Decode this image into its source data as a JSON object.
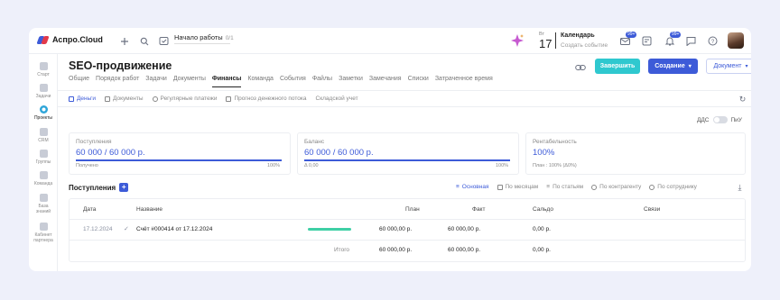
{
  "app": {
    "logo_text": "Аспро.Cloud",
    "brand_color": "#3d5bd8"
  },
  "topbar": {
    "start_work_label": "Начало работы",
    "start_work_count": "0/1",
    "calendar": {
      "day_of_week": "Вт",
      "day": "17",
      "title": "Календарь",
      "subtitle": "Создать событие"
    },
    "badges": {
      "mail": "99+",
      "notifications": "99+"
    },
    "icons": [
      "plus-icon",
      "search-icon",
      "checklist-icon",
      "sparkle-icon",
      "mail-icon",
      "note-icon",
      "bell-icon",
      "chat-icon",
      "help-icon"
    ]
  },
  "sidebar": {
    "items": [
      {
        "label": "Старт"
      },
      {
        "label": "Задачи"
      },
      {
        "label": "Проекты",
        "active": true
      },
      {
        "label": "CRM"
      },
      {
        "label": "Группы"
      },
      {
        "label": "Команда"
      },
      {
        "label": "База знаний"
      },
      {
        "label": "Кабинет партнера"
      }
    ]
  },
  "header": {
    "title": "SEO-продвижение",
    "tabs": [
      {
        "label": "Общие"
      },
      {
        "label": "Порядок работ"
      },
      {
        "label": "Задачи"
      },
      {
        "label": "Документы"
      },
      {
        "label": "Финансы",
        "active": true
      },
      {
        "label": "Команда"
      },
      {
        "label": "События"
      },
      {
        "label": "Файлы"
      },
      {
        "label": "Заметки"
      },
      {
        "label": "Замечания"
      },
      {
        "label": "Списки"
      },
      {
        "label": "Затраченное время"
      }
    ],
    "buttons": {
      "finish": "Завершить",
      "create": "Создание",
      "document": "Документ"
    }
  },
  "subtabs": [
    {
      "label": "Деньги",
      "active": true
    },
    {
      "label": "Документы"
    },
    {
      "label": "Регулярные платежи"
    },
    {
      "label": "Прогноз денежного потока"
    },
    {
      "label": "Складской учет"
    }
  ],
  "toggle": {
    "left": "ДДС",
    "right": "ПиУ"
  },
  "cards": [
    {
      "label": "Поступления",
      "value_blue": "60 000",
      "value_rest": " / 60 000 р.",
      "foot": "Получено",
      "pct": "100%",
      "progress": 1.0
    },
    {
      "label": "Баланс",
      "value_blue": "60 000",
      "value_rest": " / 60 000 р.",
      "foot": "Δ 0,00",
      "pct": "100%",
      "progress": 1.0
    },
    {
      "label": "Рентабельность",
      "value_blue": "100%",
      "value_rest": "",
      "foot": "План : 100% (Δ0%)",
      "pct": "",
      "progress": 0
    }
  ],
  "section": {
    "title": "Поступления",
    "views": [
      {
        "label": "Основная",
        "active": true
      },
      {
        "label": "По месяцам"
      },
      {
        "label": "По статьям"
      },
      {
        "label": "По контрагенту"
      },
      {
        "label": "По сотруднику"
      }
    ]
  },
  "table": {
    "columns": [
      "Дата",
      "Название",
      "План",
      "Факт",
      "Сальдо",
      "Связи"
    ],
    "rows": [
      {
        "date": "17.12.2024",
        "name": "Счёт #000414 от 17.12.2024",
        "plan": "60 000,00 р.",
        "fact": "60 000,00 р.",
        "saldo": "0,00 р.",
        "progress": 1.0
      }
    ],
    "total": {
      "label": "Итого",
      "plan": "60 000,00 р.",
      "fact": "60 000,00 р.",
      "saldo": "0,00 р."
    }
  }
}
